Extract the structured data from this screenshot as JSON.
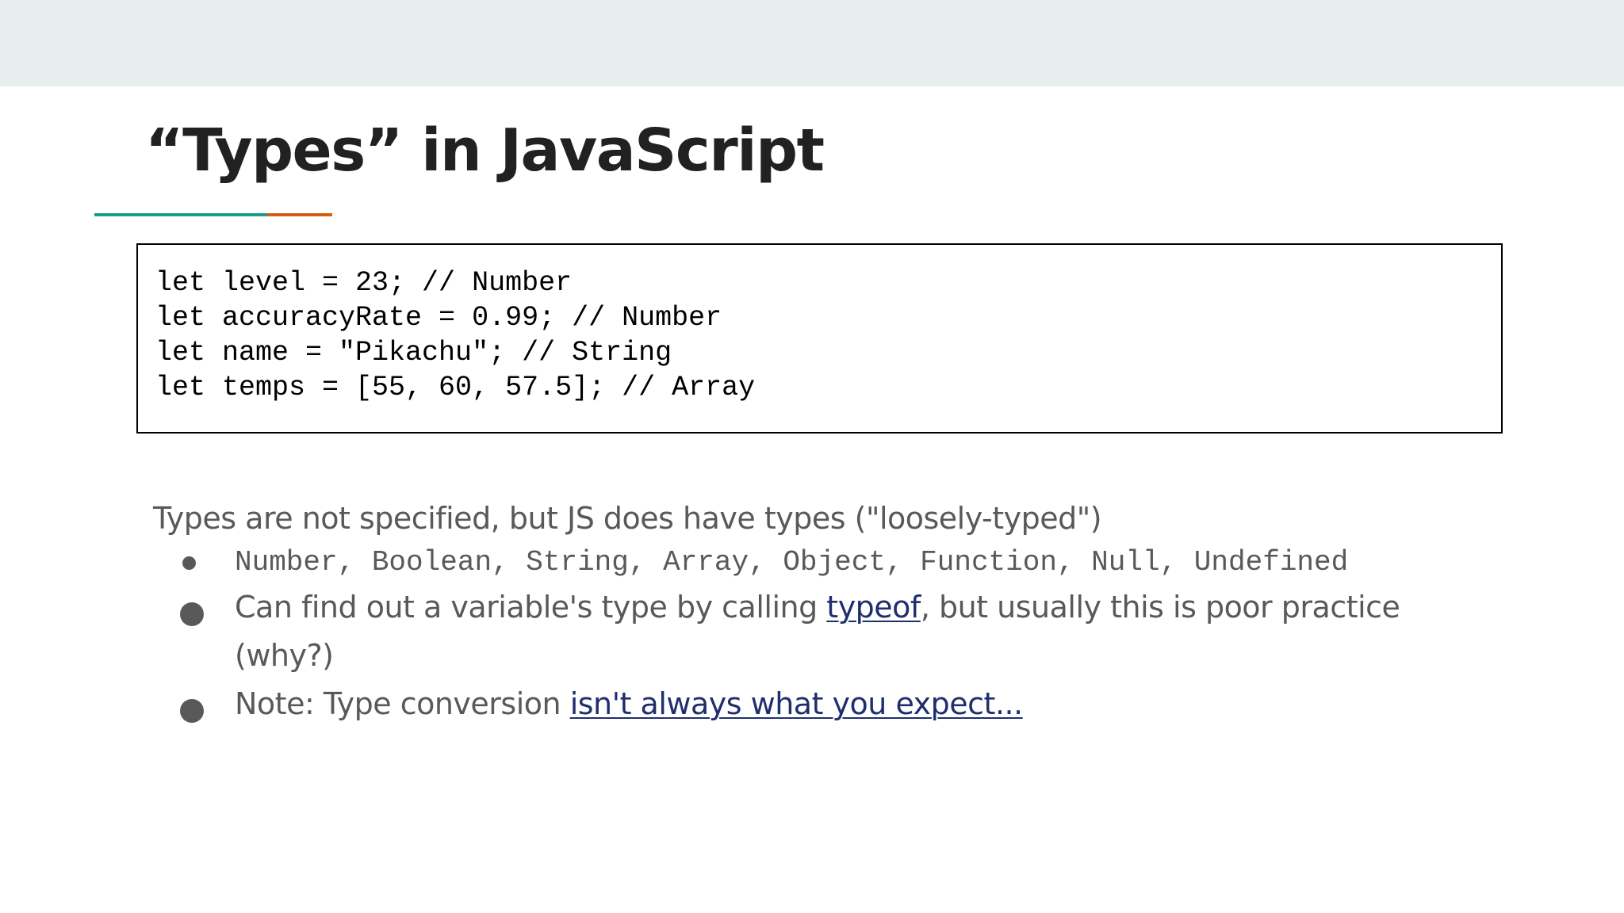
{
  "slide": {
    "title": "“Types” in JavaScript",
    "colors": {
      "top_band": "#e8eeee",
      "accent_teal": "#1d9a8a",
      "accent_orange": "#d35f10",
      "link": "#1f2f6e",
      "body_text": "#595959"
    }
  },
  "code": {
    "lines": [
      "let level = 23; // Number",
      "let accuracyRate = 0.99; // Number",
      "let name = \"Pikachu\"; // String",
      "let temps = [55, 60, 57.5]; // Array"
    ]
  },
  "content": {
    "intro": "Types are not specified, but JS does have types (\"loosely-typed\")",
    "bullets": {
      "types_list": "Number, Boolean, String, Array, Object, Function, Null, Undefined",
      "typeof_before": "Can find out a variable's type by calling ",
      "typeof_link": "typeof",
      "typeof_after": ", but usually this is poor practice (why?)",
      "note_before": "Note: Type conversion ",
      "note_link": "isn't always what you expect..."
    }
  }
}
